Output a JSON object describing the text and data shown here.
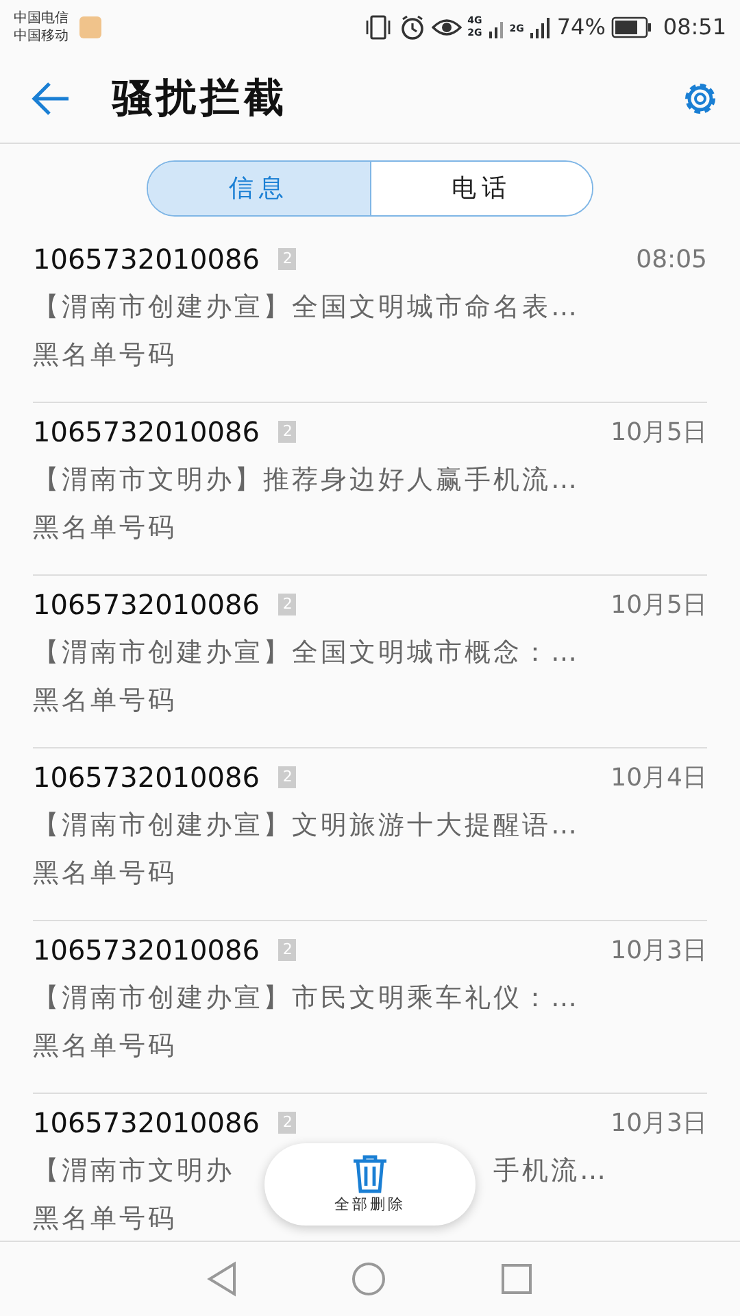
{
  "status_bar": {
    "carriers": [
      "中国电信",
      "中国移动"
    ],
    "signal_labels": [
      "4G",
      "2G",
      "2G"
    ],
    "battery": "74%",
    "time": "08:51"
  },
  "header": {
    "title": "骚扰拦截"
  },
  "tabs": [
    {
      "label": "信息",
      "selected": true
    },
    {
      "label": "电话",
      "selected": false
    }
  ],
  "messages": [
    {
      "sender": "1065732010086",
      "sim": "2",
      "time": "08:05",
      "snippet": "【渭南市创建办宣】全国文明城市命名表…",
      "tag": "黑名单号码"
    },
    {
      "sender": "1065732010086",
      "sim": "2",
      "time": "10月5日",
      "snippet": "【渭南市文明办】推荐身边好人赢手机流…",
      "tag": "黑名单号码"
    },
    {
      "sender": "1065732010086",
      "sim": "2",
      "time": "10月5日",
      "snippet": "【渭南市创建办宣】全国文明城市概念：…",
      "tag": "黑名单号码"
    },
    {
      "sender": "1065732010086",
      "sim": "2",
      "time": "10月4日",
      "snippet": "【渭南市创建办宣】文明旅游十大提醒语…",
      "tag": "黑名单号码"
    },
    {
      "sender": "1065732010086",
      "sim": "2",
      "time": "10月3日",
      "snippet": "【渭南市创建办宣】市民文明乘车礼仪：…",
      "tag": "黑名单号码"
    },
    {
      "sender": "1065732010086",
      "sim": "2",
      "time": "10月3日",
      "snippet_parts": [
        "【渭南市文明办",
        "手机流…"
      ],
      "tag": "黑名单号码"
    }
  ],
  "delete_all": {
    "label": "全部删除"
  }
}
